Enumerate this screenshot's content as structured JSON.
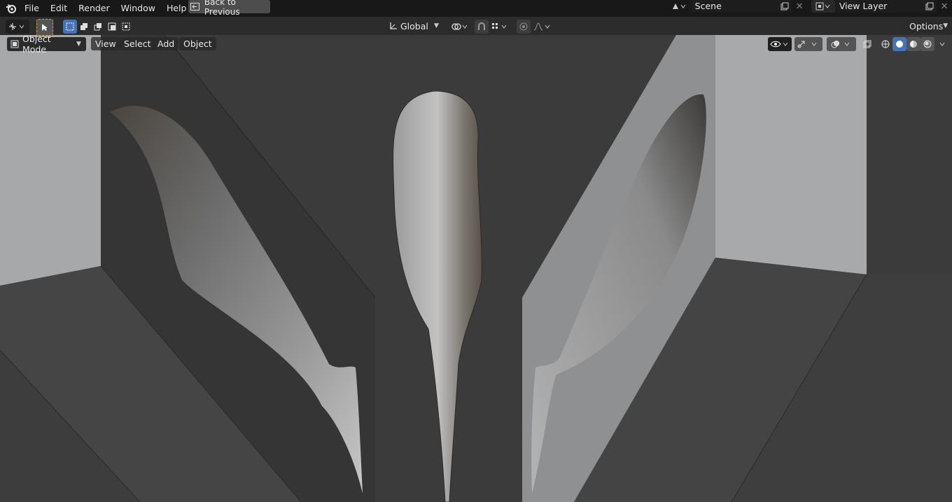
{
  "menu": {
    "items": [
      "File",
      "Edit",
      "Render",
      "Window",
      "Help"
    ],
    "back_label": "Back to Previous"
  },
  "scene": {
    "name": "Scene"
  },
  "view_layer": {
    "name": "View Layer"
  },
  "toolbar": {
    "transform_orientation": "Global",
    "options_label": "Options"
  },
  "viewport_header": {
    "mode": "Object Mode",
    "menus": [
      "View",
      "Select",
      "Add",
      "Object"
    ]
  },
  "icons": {
    "logo": "blender-logo-icon",
    "back": "back-arrow-icon",
    "select": "select-cursor-icon",
    "snap": "magnet-icon",
    "proportional": "proportional-edit-icon"
  },
  "colors": {
    "topbar": "#181818",
    "toolbar": "#2c2c2c",
    "accent": "#4772b3",
    "viewport": "#3a3a3a"
  }
}
